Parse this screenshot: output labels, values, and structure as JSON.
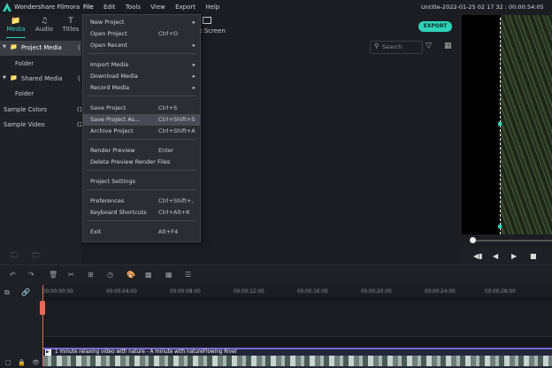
{
  "app": {
    "name": "Wondershare Filmora",
    "project_title": "Untitle-2022-01-25 02 17 32 : 00:00:54:05"
  },
  "menubar": [
    "File",
    "Edit",
    "Tools",
    "View",
    "Export",
    "Help"
  ],
  "tabs": [
    {
      "label": "Media",
      "icon": "folder-icon"
    },
    {
      "label": "Audio",
      "icon": "music-icon"
    },
    {
      "label": "Titles",
      "icon": "text-icon"
    }
  ],
  "split_screen_label": "lit Screen",
  "export_label": "EXPORT",
  "search_placeholder": "Search",
  "left_panel": [
    {
      "label": "Project Media",
      "count": "(",
      "selected": true
    },
    {
      "label": "Folder",
      "count": ""
    },
    {
      "label": "Shared Media",
      "count": "("
    },
    {
      "label": "Folder",
      "count": ""
    },
    {
      "label": "Sample Colors",
      "count": "(1"
    },
    {
      "label": "Sample Video",
      "count": "(2"
    }
  ],
  "file_menu": [
    {
      "label": "New Project",
      "shortcut": "",
      "submenu": true
    },
    {
      "label": "Open Project",
      "shortcut": "Ctrl+O"
    },
    {
      "label": "Open Recent",
      "shortcut": "",
      "submenu": true
    },
    {
      "label": "Import Media",
      "shortcut": "",
      "submenu": true
    },
    {
      "label": "Download Media",
      "shortcut": "",
      "submenu": true
    },
    {
      "label": "Record Media",
      "shortcut": "",
      "submenu": true
    },
    {
      "label": "Save Project",
      "shortcut": "Ctrl+S"
    },
    {
      "label": "Save Project As...",
      "shortcut": "Ctrl+Shift+S",
      "highlighted": true
    },
    {
      "label": "Archive Project",
      "shortcut": "Ctrl+Shift+A"
    },
    {
      "label": "Render Preview",
      "shortcut": "Enter"
    },
    {
      "label": "Delete Preview Render Files",
      "shortcut": ""
    },
    {
      "label": "Project Settings",
      "shortcut": ""
    },
    {
      "label": "Preferences",
      "shortcut": "Ctrl+Shift+,"
    },
    {
      "label": "Keyboard Shortcuts",
      "shortcut": "Ctrl+Alt+K"
    },
    {
      "label": "Exit",
      "shortcut": "Alt+F4"
    }
  ],
  "ruler_ticks": [
    "00:00:00:00",
    "00:00:04:00",
    "00:00:08:00",
    "00:00:12:00",
    "00:00:16:00",
    "00:00:20:00",
    "00:00:24:00",
    "00:00:28:00"
  ],
  "clip_label": "1 minute relaxing video with nature - A minute with natureFlowing  River"
}
